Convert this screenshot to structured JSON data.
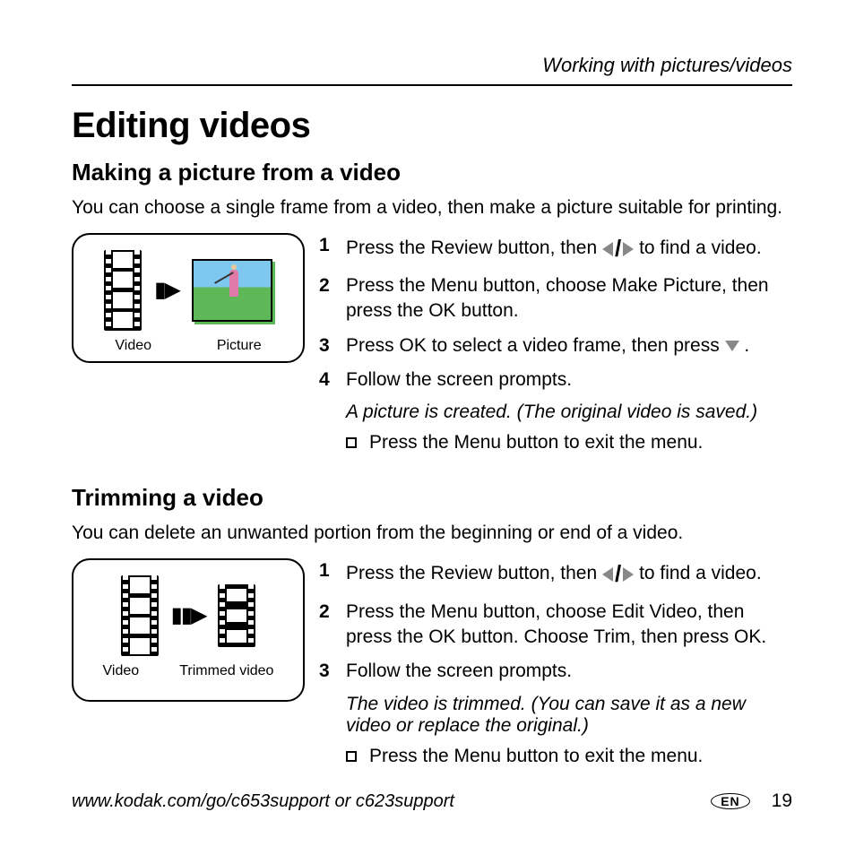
{
  "header": {
    "section_title": "Working with pictures/videos"
  },
  "h1": "Editing videos",
  "section1": {
    "heading": "Making a picture from a video",
    "intro": "You can choose a single frame from a video, then make a picture suitable for printing.",
    "illus": {
      "label_left": "Video",
      "label_right": "Picture"
    },
    "steps": {
      "s1a": "Press the Review button, then ",
      "s1b": " to find a video.",
      "s2": "Press the Menu button, choose Make Picture, then press the OK button.",
      "s3a": "Press OK to select a video frame, then press ",
      "s3b": ".",
      "s4": "Follow the screen prompts.",
      "result": "A picture is created. (The original video is saved.)",
      "exit": "Press the Menu button to exit the menu."
    }
  },
  "section2": {
    "heading": "Trimming a video",
    "intro": "You can delete an unwanted portion from the beginning or end of a video.",
    "illus": {
      "label_left": "Video",
      "label_right": "Trimmed video"
    },
    "steps": {
      "s1a": "Press the Review button, then ",
      "s1b": " to find a video.",
      "s2": "Press the Menu button, choose Edit Video, then press the OK button. Choose Trim, then press OK.",
      "s3": "Follow the screen prompts.",
      "result": "The video is trimmed. (You can save it as a new video or replace the original.)",
      "exit": "Press the Menu button to exit the menu."
    }
  },
  "footer": {
    "url": "www.kodak.com/go/c653support or c623support",
    "lang": "EN",
    "page": "19"
  }
}
